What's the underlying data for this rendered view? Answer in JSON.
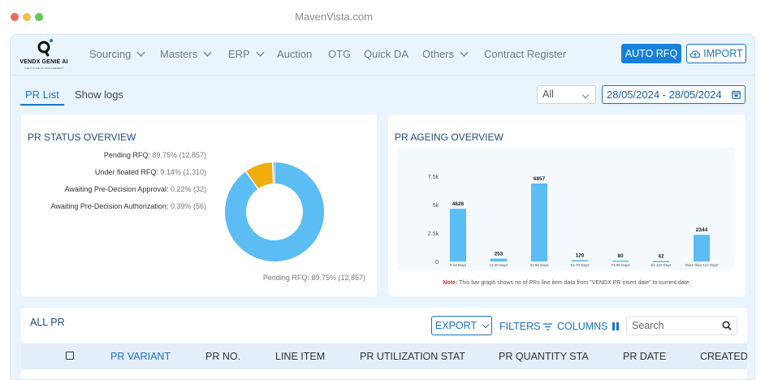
{
  "browser": {
    "url": "MavenVista.com"
  },
  "brand": {
    "name": "VENDX GENIE AI",
    "tagline": "THE FUTURE OF PROCUREMENT"
  },
  "nav": {
    "items": [
      {
        "label": "Sourcing",
        "dropdown": true
      },
      {
        "label": "Masters",
        "dropdown": true
      },
      {
        "label": "ERP",
        "dropdown": true
      },
      {
        "label": "Auction",
        "dropdown": false
      },
      {
        "label": "OTG",
        "dropdown": false
      },
      {
        "label": "Quick DA",
        "dropdown": false
      },
      {
        "label": "Others",
        "dropdown": true
      },
      {
        "label": "Contract Register",
        "dropdown": false
      }
    ],
    "auto_rfq": "AUTO RFQ",
    "import": "IMPORT"
  },
  "tabs": {
    "pr_list": "PR List",
    "show_logs": "Show logs"
  },
  "filter": {
    "selected": "All",
    "date_range": "28/05/2024 - 28/05/2024"
  },
  "status_overview": {
    "title": "PR STATUS OVERVIEW",
    "labels": [
      {
        "name": "Pending RFQ:",
        "value": "89.75% (12,857)"
      },
      {
        "name": "Under floated RFQ:",
        "value": "9.14% (1,310)"
      },
      {
        "name": "Awaiting Pre-Decision Approval:",
        "value": "0.22% (32)"
      },
      {
        "name": "Awaiting Pre-Decision Authorization:",
        "value": "0.39% (56)"
      }
    ],
    "bottom_label": {
      "name": "Pending RFQ:",
      "value": "89.75% (12,857)"
    }
  },
  "ageing_overview": {
    "title": "PR AGEING OVERVIEW",
    "note_prefix": "Note:",
    "note_text": "This bar graph shows no of PRs line item data from \"VENDX PR insert date\" to current date."
  },
  "chart_data": [
    {
      "type": "pie",
      "title": "PR STATUS OVERVIEW",
      "donut": true,
      "slices": [
        {
          "name": "Pending RFQ",
          "value": 12857,
          "percent": 89.75,
          "color": "#5bbdf3"
        },
        {
          "name": "Under floated RFQ",
          "value": 1310,
          "percent": 9.14,
          "color": "#f0ad0e"
        },
        {
          "name": "Awaiting Pre-Decision Approval",
          "value": 32,
          "percent": 0.22,
          "color": "#8bd17c"
        },
        {
          "name": "Awaiting Pre-Decision Authorization",
          "value": 56,
          "percent": 0.39,
          "color": "#2f6fb3"
        }
      ]
    },
    {
      "type": "bar",
      "title": "PR AGEING OVERVIEW",
      "categories": [
        "0-10 Days",
        "11-30 Days",
        "31-50 Days",
        "51-70 Days",
        "71-90 Days",
        "91-110 Days",
        "More than 110 Days"
      ],
      "values": [
        4626,
        253,
        6857,
        120,
        80,
        42,
        2344
      ],
      "yticks": [
        "0",
        "2.5k",
        "5k",
        "7.5k"
      ],
      "ylim": [
        0,
        7500
      ],
      "color": "#5bbdf3",
      "grid": false
    }
  ],
  "all_pr": {
    "title": "ALL PR",
    "export": "EXPORT",
    "filters": "FILTERS",
    "columns": "COLUMNS",
    "search_placeholder": "Search",
    "headers": [
      "PR VARIANT",
      "PR NO.",
      "LINE ITEM",
      "PR UTILIZATION STAT",
      "PR QUANTITY STA",
      "PR DATE",
      "CREATED"
    ]
  }
}
